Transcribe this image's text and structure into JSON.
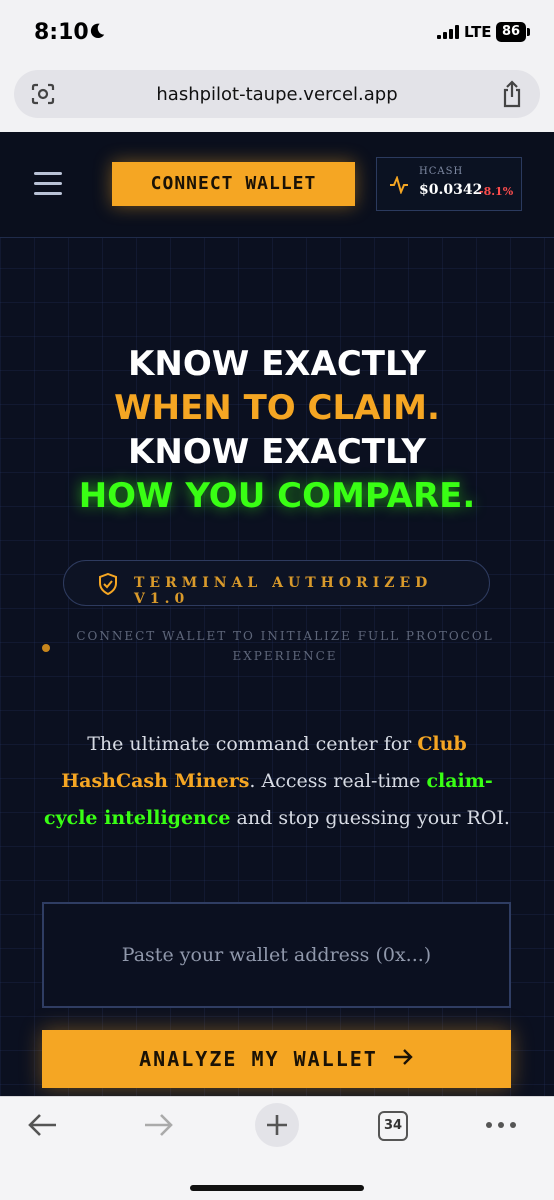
{
  "status_bar": {
    "time": "8:10",
    "network": "LTE",
    "battery": "86"
  },
  "browser": {
    "url": "hashpilot-taupe.vercel.app",
    "tab_count": "34"
  },
  "nav": {
    "connect_label": "CONNECT WALLET",
    "ticker": {
      "symbol": "HCASH",
      "price": "$0.0342",
      "change": "-8.1%"
    }
  },
  "hero": {
    "line1": "KNOW EXACTLY",
    "line2": "WHEN TO CLAIM.",
    "line3": "KNOW EXACTLY",
    "line4": "HOW YOU COMPARE."
  },
  "auth_badge": "TERMINAL AUTHORIZED V1.0",
  "connect_note": "CONNECT WALLET TO INITIALIZE FULL PROTOCOL EXPERIENCE",
  "description": {
    "part1": "The ultimate command center for ",
    "highlight1": "Club HashCash Miners",
    "part2": ". Access real-time ",
    "highlight2": "claim-cycle intelligence",
    "part3": " and stop guessing your ROI."
  },
  "wallet_input": {
    "placeholder": "Paste your wallet address (0x...)",
    "value": ""
  },
  "analyze_label": "ANALYZE MY WALLET",
  "colors": {
    "accent": "#f5a623",
    "neon_green": "#39ff14",
    "background": "#0b1020",
    "negative": "#ff4d4d"
  }
}
